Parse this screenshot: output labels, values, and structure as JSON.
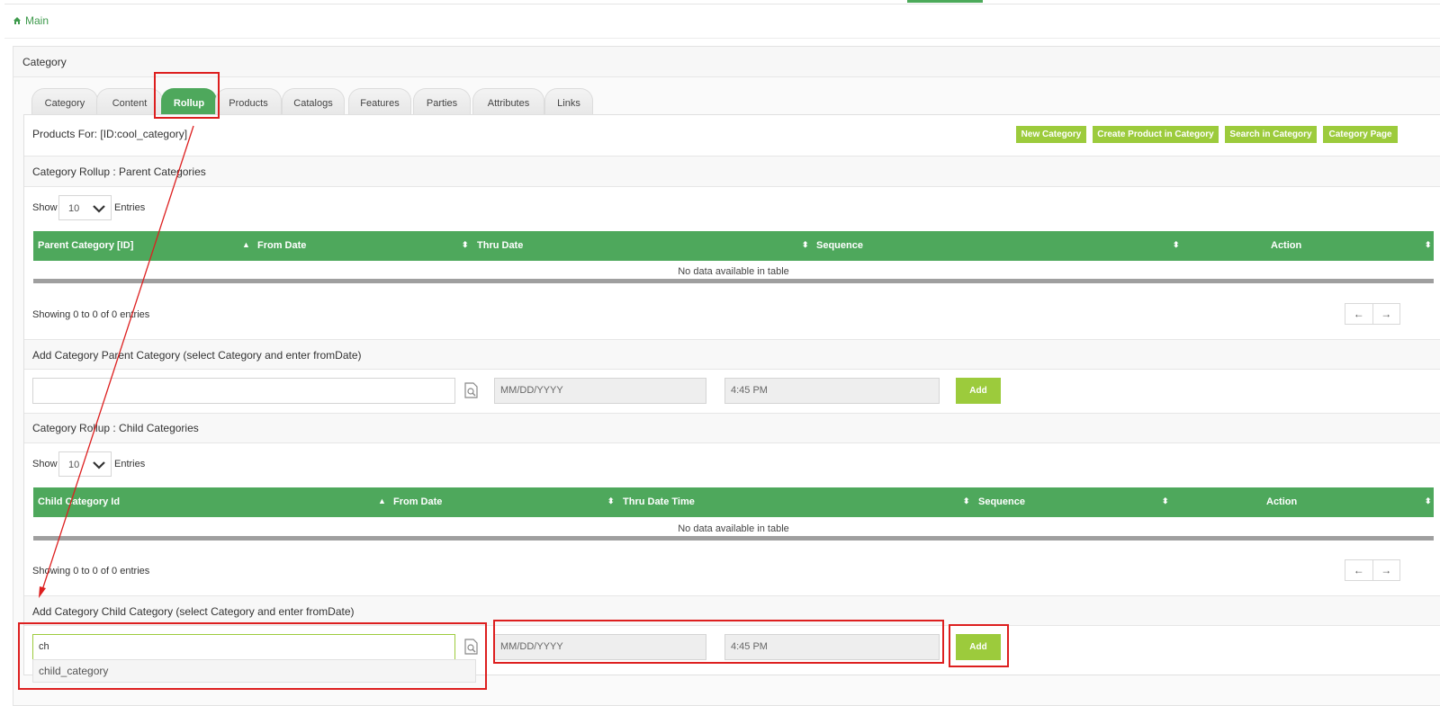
{
  "breadcrumb": {
    "label": "Main"
  },
  "section_title": "Category",
  "tabs": [
    {
      "label": "Category"
    },
    {
      "label": "Content"
    },
    {
      "label": "Rollup",
      "active": true
    },
    {
      "label": "Products"
    },
    {
      "label": "Catalogs"
    },
    {
      "label": "Features"
    },
    {
      "label": "Parties"
    },
    {
      "label": "Attributes"
    },
    {
      "label": "Links"
    }
  ],
  "products_for": "Products For: [ID:cool_category]",
  "top_buttons": [
    {
      "label": "New Category"
    },
    {
      "label": "Create Product in Category"
    },
    {
      "label": "Search in Category"
    },
    {
      "label": "Category Page"
    }
  ],
  "parent_section": {
    "title": "Category Rollup : Parent Categories",
    "show_label": "Show",
    "entries_value": "10",
    "entries_label": "Entries",
    "columns": [
      "Parent Category [ID]",
      "From Date",
      "Thru Date",
      "Sequence",
      "Action"
    ],
    "empty_text": "No data available in table",
    "showing_text": "Showing 0 to 0 of 0 entries",
    "add_title": "Add Category Parent Category (select Category and enter fromDate)",
    "category_value": "",
    "date_placeholder": "MM/DD/YYYY",
    "time_value": "4:45 PM",
    "add_label": "Add"
  },
  "child_section": {
    "title": "Category Rollup : Child Categories",
    "show_label": "Show",
    "entries_value": "10",
    "entries_label": "Entries",
    "columns": [
      "Child Category Id",
      "From Date",
      "Thru Date Time",
      "Sequence",
      "Action"
    ],
    "empty_text": "No data available in table",
    "showing_text": "Showing 0 to 0 of 0 entries",
    "add_title": "Add Category Child Category (select Category and enter fromDate)",
    "category_value": "ch",
    "date_placeholder": "MM/DD/YYYY",
    "time_value": "4:45 PM",
    "add_label": "Add",
    "suggestion": "child_category"
  },
  "pager": {
    "prev": "←",
    "next": "→"
  },
  "colors": {
    "green": "#4ea85c",
    "lime": "#9ccb3c",
    "annotation_red": "#dd1f1f"
  },
  "icons": {
    "home": "home-icon",
    "lookup": "lookup-icon",
    "dropdown": "chevron-down-icon",
    "sort": "sort-icon"
  }
}
